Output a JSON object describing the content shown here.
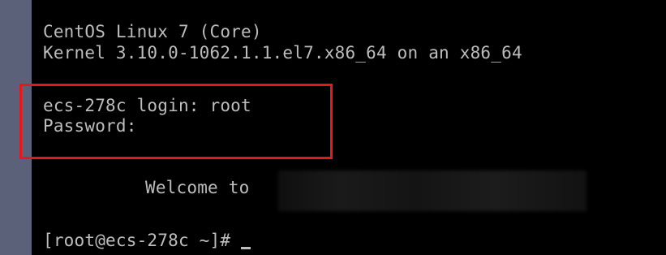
{
  "console": {
    "os_line": "CentOS Linux 7 (Core)",
    "kernel_line": "Kernel 3.10.0-1062.1.1.el7.x86_64 on an x86_64",
    "login_line": "ecs-278c login: root",
    "password_line": "Password:",
    "welcome_text": "Welcome to",
    "prompt": "[root@ecs-278c ~]# "
  },
  "colors": {
    "text": "#bdbdbd",
    "background": "#000000",
    "highlight_border": "#e5191b",
    "left_bar": "#5a6178"
  }
}
